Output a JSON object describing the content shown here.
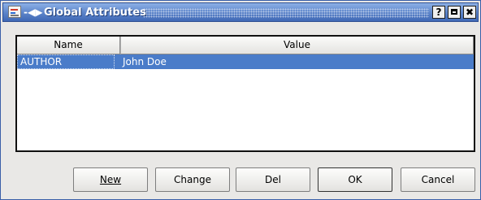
{
  "window": {
    "title": "Global Attributes",
    "pin_glyph": "-◀▶",
    "help_glyph": "?",
    "close_glyph": "✖"
  },
  "table": {
    "columns": [
      "Name",
      "Value"
    ],
    "rows": [
      {
        "name": "AUTHOR",
        "value": "John Doe",
        "selected": true
      }
    ]
  },
  "buttons": {
    "new_label": "New",
    "change_label": "Change",
    "del_label": "Del",
    "ok_label": "OK",
    "cancel_label": "Cancel"
  },
  "colors": {
    "titlebar": "#4f78c1",
    "selection": "#4a7cc9"
  }
}
